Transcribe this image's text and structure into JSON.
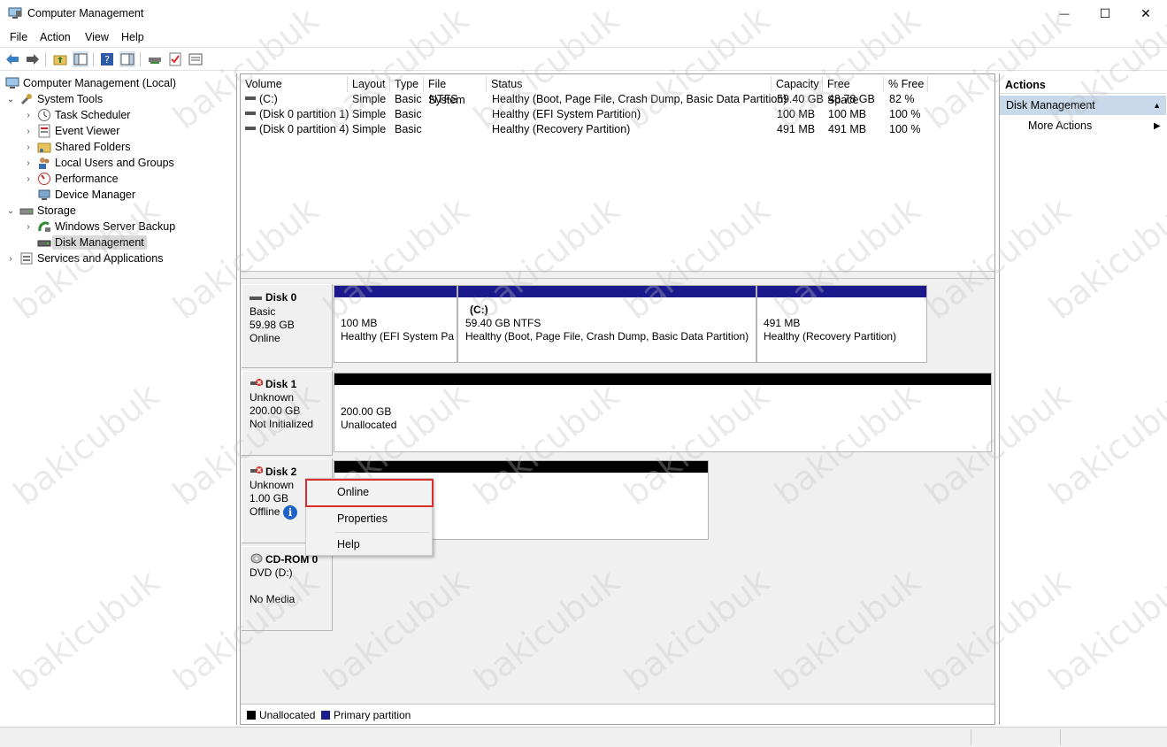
{
  "window": {
    "title": "Computer Management",
    "minimize_glyph": "—",
    "maximize_glyph": "☐",
    "close_glyph": "✕"
  },
  "menu": [
    "File",
    "Action",
    "View",
    "Help"
  ],
  "toolbar": {
    "icons": [
      "back-arrow-icon",
      "forward-arrow-icon",
      "folder-up-icon",
      "console-tree-icon",
      "help-icon",
      "action-pane-icon",
      "connect-icon",
      "check-icon",
      "properties-icon"
    ]
  },
  "tree": {
    "root": "Computer Management (Local)",
    "system_tools": "System Tools",
    "task_scheduler": "Task Scheduler",
    "event_viewer": "Event Viewer",
    "shared_folders": "Shared Folders",
    "local_users": "Local Users and Groups",
    "performance": "Performance",
    "device_manager": "Device Manager",
    "storage": "Storage",
    "server_backup": "Windows Server Backup",
    "disk_management": "Disk Management",
    "services": "Services and Applications",
    "chevron_open": "⌄",
    "chevron_closed": "›"
  },
  "volume_table": {
    "columns": [
      "Volume",
      "Layout",
      "Type",
      "File System",
      "Status",
      "Capacity",
      "Free Space",
      "% Free"
    ],
    "rows": [
      [
        "(C:)",
        "Simple",
        "Basic",
        "NTFS",
        "Healthy (Boot, Page File, Crash Dump, Basic Data Partition)",
        "59.40 GB",
        "48.78 GB",
        "82 %"
      ],
      [
        "(Disk 0 partition 1)",
        "Simple",
        "Basic",
        "",
        "Healthy (EFI System Partition)",
        "100 MB",
        "100 MB",
        "100 %"
      ],
      [
        "(Disk 0 partition 4)",
        "Simple",
        "Basic",
        "",
        "Healthy (Recovery Partition)",
        "491 MB",
        "491 MB",
        "100 %"
      ]
    ]
  },
  "disks": {
    "disk0": {
      "name": "Disk 0",
      "type": "Basic",
      "size": "59.98 GB",
      "status": "Online",
      "partitions": [
        {
          "line1": "100 MB",
          "line2": "Healthy (EFI System Par"
        },
        {
          "title": "(C:)",
          "line1": "59.40 GB NTFS",
          "line2": "Healthy (Boot, Page File, Crash Dump, Basic Data Partition)"
        },
        {
          "line1": "491 MB",
          "line2": "Healthy (Recovery Partition)"
        }
      ]
    },
    "disk1": {
      "name": "Disk 1",
      "type": "Unknown",
      "size": "200.00 GB",
      "status": "Not Initialized",
      "partition": {
        "line1": "200.00 GB",
        "line2": "Unallocated"
      }
    },
    "disk2": {
      "name": "Disk 2",
      "type": "Unknown",
      "size": "1.00 GB",
      "status": "Offline",
      "info_glyph": "i"
    },
    "cdrom0": {
      "name": "CD-ROM 0",
      "type": "DVD (D:)",
      "status": "No Media"
    }
  },
  "legend": {
    "unallocated": "Unallocated",
    "primary": "Primary partition",
    "colors": {
      "unallocated": "#000000",
      "primary": "#1a1a8c"
    }
  },
  "actions": {
    "title": "Actions",
    "section": "Disk Management",
    "more": "More Actions",
    "collapse_glyph": "▲",
    "more_glyph": "▶"
  },
  "context_menu": {
    "items": [
      "Online",
      "Properties",
      "Help"
    ]
  },
  "watermark": "bakicubuk",
  "colors": {
    "primary_partition_bar": "#1a1a8c",
    "unallocated_bar": "#000000",
    "selection": "#d9d9d9",
    "actions_section_bg": "#c7d9ea",
    "highlight_border": "#d9302c"
  }
}
